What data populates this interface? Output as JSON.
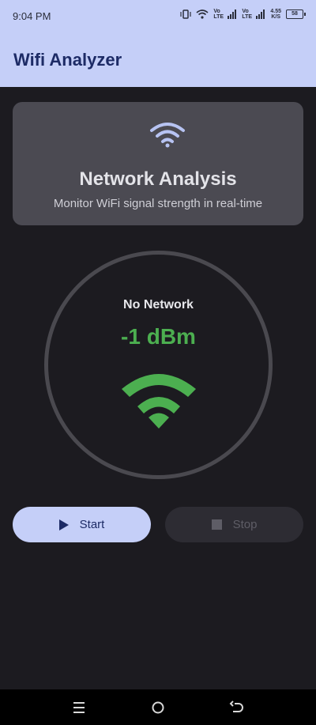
{
  "status_bar": {
    "time": "9:04 PM",
    "net_speed": "4.55",
    "net_speed_unit": "K/S",
    "volte1": "Vo LTE",
    "volte2": "Vo LTE",
    "battery": "58"
  },
  "app_bar": {
    "title": "Wifi Analyzer"
  },
  "header": {
    "title": "Network Analysis",
    "subtitle": "Monitor WiFi signal strength in real-time"
  },
  "gauge": {
    "network_name": "No Network",
    "signal": "-1 dBm"
  },
  "buttons": {
    "start_label": "Start",
    "stop_label": "Stop"
  },
  "colors": {
    "accent": "#c5cff8",
    "signal_good": "#4caf50",
    "background": "#1c1b20"
  },
  "icons": [
    "wifi-icon",
    "play-icon",
    "stop-icon",
    "menu-icon",
    "home-icon",
    "back-icon"
  ]
}
